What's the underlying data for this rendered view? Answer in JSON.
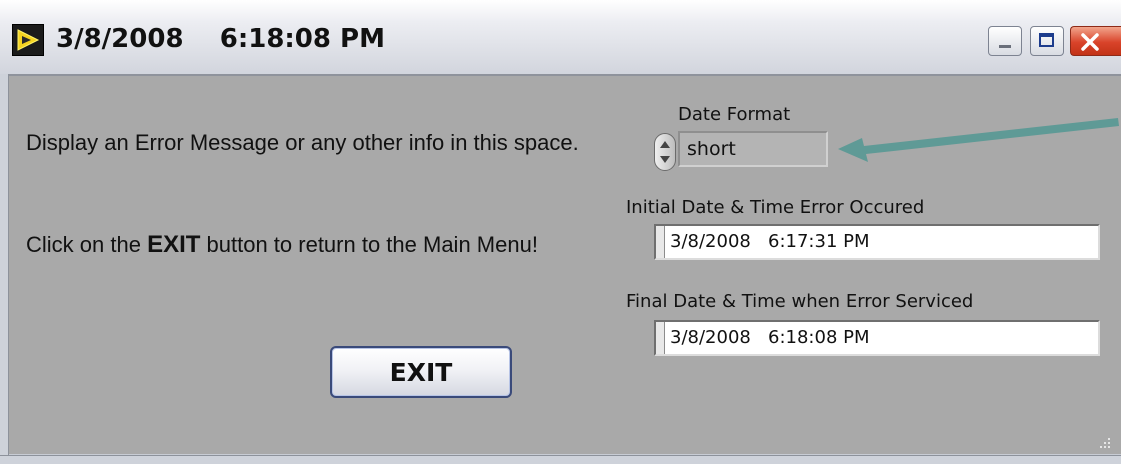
{
  "window": {
    "title": "3/8/2008    6:18:08 PM"
  },
  "panel": {
    "info_message": "Display an Error Message or any other info in this space.",
    "exit_instruction": {
      "prefix": "Click on the ",
      "bold": "EXIT",
      "suffix": " button to return to the Main Menu!"
    },
    "exit_button_label": "EXIT",
    "date_format": {
      "label": "Date Format",
      "value": "short"
    },
    "initial_time": {
      "label": "Initial Date & Time Error Occured",
      "value": "3/8/2008   6:17:31 PM"
    },
    "final_time": {
      "label": "Final Date & Time when Error Serviced",
      "value": "3/8/2008   6:18:08 PM"
    }
  },
  "colors": {
    "panel_background": "#a9a9a9",
    "arrow": "#5f9a96",
    "close_button": "#d9432a"
  },
  "icons": [
    "labview-app-icon",
    "minimize-icon",
    "maximize-icon",
    "close-icon",
    "ring-arrows-icon",
    "annotation-arrow",
    "resize-grip-icon"
  ]
}
